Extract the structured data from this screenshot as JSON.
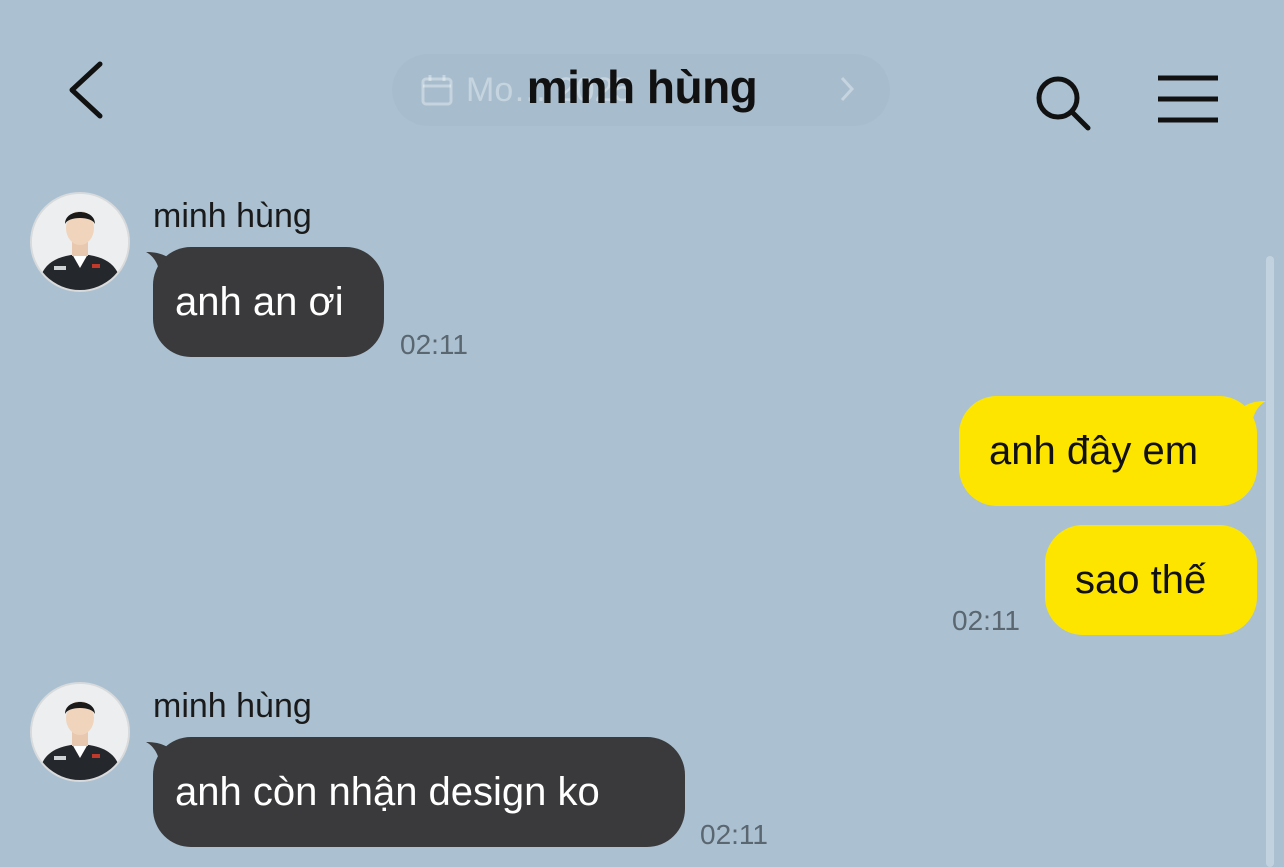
{
  "header": {
    "title": "minh hùng",
    "date_pill": {
      "text": "Mo… 2025"
    }
  },
  "colors": {
    "background": "#abc1d1",
    "received_bubble": "#3a3a3c",
    "sent_bubble": "#fee500"
  },
  "icons": {
    "back": "chevron-left-icon",
    "calendar": "calendar-icon",
    "search": "search-icon",
    "menu": "hamburger-menu-icon"
  },
  "messages": [
    {
      "direction": "received",
      "sender": "minh hùng",
      "text": "anh an ơi",
      "time": "02:11"
    },
    {
      "direction": "sent",
      "text": "anh đây em"
    },
    {
      "direction": "sent",
      "text": "sao thế",
      "time": "02:11"
    },
    {
      "direction": "received",
      "sender": "minh hùng",
      "text": "anh còn nhận design ko",
      "time": "02:11"
    }
  ]
}
